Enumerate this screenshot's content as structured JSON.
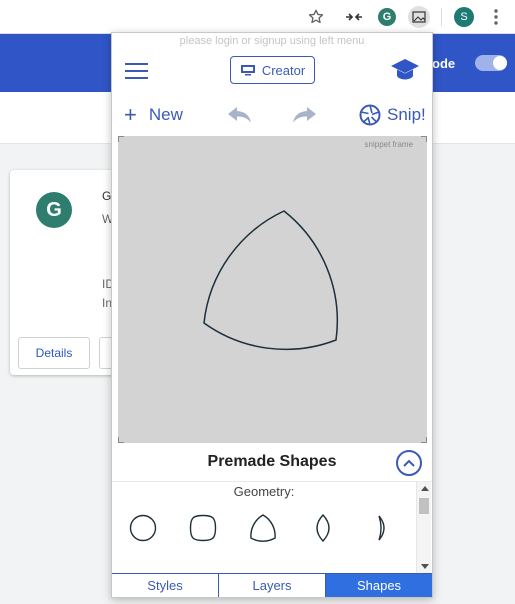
{
  "browser": {
    "profile_initial": "S",
    "ext_grammarly_letter": "G"
  },
  "background_page": {
    "mode_label": "ode",
    "card": {
      "logo_letter": "G",
      "line1": "G",
      "line2": "W",
      "line3": "ID",
      "line4": "In",
      "details_button": "Details"
    }
  },
  "popup": {
    "notice": "please login or signup using left menu",
    "creator_button": "Creator",
    "toolbar": {
      "new_label": "New",
      "snip_label": "Snip!"
    },
    "canvas": {
      "frame_label": "snippet frame"
    },
    "premade": {
      "title": "Premade Shapes",
      "category": "Geometry:",
      "shapes": [
        "circle",
        "squircle",
        "reuleaux-triangle",
        "vesica",
        "crescent"
      ]
    },
    "tabs": [
      {
        "label": "Styles",
        "active": false
      },
      {
        "label": "Layers",
        "active": false
      },
      {
        "label": "Shapes",
        "active": true
      }
    ]
  },
  "colors": {
    "accent": "#3b5ab8",
    "active_tab": "#2f6fe0",
    "fab": "#3b6fd8",
    "canvas_bg": "#d3d3d3",
    "page_header": "#2f55c6"
  }
}
